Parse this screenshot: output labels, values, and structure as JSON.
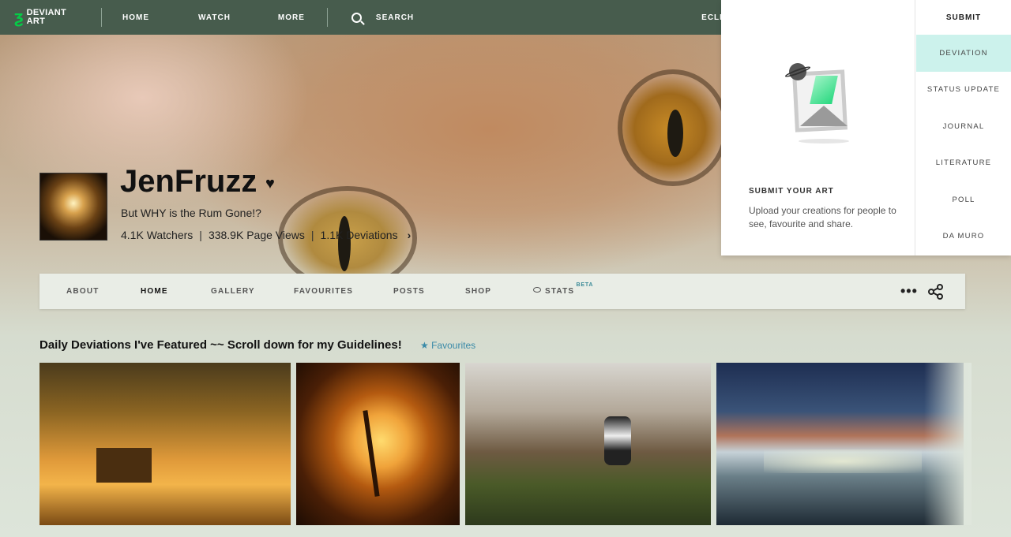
{
  "topbar": {
    "logo_text_line1": "DEVIANT",
    "logo_text_line2": "ART",
    "nav": [
      "HOME",
      "WATCH",
      "MORE"
    ],
    "search_label": "SEARCH",
    "user_partial": "ECLIPS"
  },
  "submit_menu": {
    "heading": "SUBMIT",
    "items": [
      "DEVIATION",
      "STATUS UPDATE",
      "JOURNAL",
      "LITERATURE",
      "POLL",
      "DA MURO"
    ],
    "active_item": "DEVIATION",
    "promo_title": "SUBMIT YOUR ART",
    "promo_desc": "Upload your creations for people to see, favourite and share."
  },
  "profile": {
    "username": "JenFruzz",
    "tagline": "But WHY is the Rum Gone!?",
    "watchers": "4.1K Watchers",
    "page_views": "338.9K Page Views",
    "deviations": "1.1K Deviations",
    "separator": "|"
  },
  "tabs": {
    "items": [
      "ABOUT",
      "HOME",
      "GALLERY",
      "FAVOURITES",
      "POSTS",
      "SHOP",
      "STATS"
    ],
    "active": "HOME",
    "stats_badge": "BETA"
  },
  "section": {
    "title": "Daily Deviations I've Featured ~~ Scroll down for my Guidelines!",
    "tag": "Favourites"
  },
  "colors": {
    "topbar_bg": "#475c4d",
    "accent_green": "#05cc47",
    "active_submit_bg": "#ccf2ec",
    "link_blue": "#3a8aa8"
  }
}
